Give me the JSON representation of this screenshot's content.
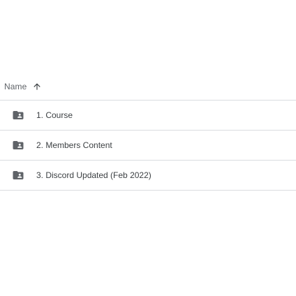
{
  "header": {
    "name_label": "Name",
    "sort_icon": "arrow-up-icon"
  },
  "files": [
    {
      "name": "1. Course",
      "icon": "shared-folder-icon"
    },
    {
      "name": "2. Members Content",
      "icon": "shared-folder-icon"
    },
    {
      "name": "3. Discord Updated (Feb 2022)",
      "icon": "shared-folder-icon"
    }
  ],
  "colors": {
    "icon": "#5f6368",
    "text": "#3c4043",
    "header_text": "#5f6368",
    "divider": "#dadce0"
  }
}
